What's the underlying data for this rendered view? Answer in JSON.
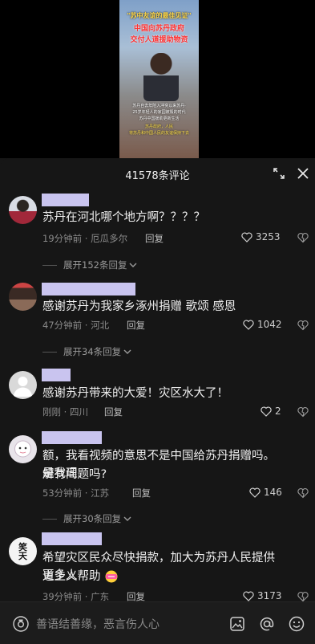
{
  "video": {
    "thumb_title_1": "\"苏中友谊的最佳见证\"",
    "thumb_title_2": "中国向苏丹政府",
    "thumb_title_3": "交付人道援助物资",
    "thumb_caption_lines": [
      "苏丹自去年陷入冲突以来苏丹·",
      "25岁年轻人的家园被毁的时代",
      "苏丹中国援助更新生活",
      "苏丹政府，人民",
      "将苏丹和中国人民的友谊保持下去"
    ]
  },
  "panel": {
    "title": "41578条评论"
  },
  "comments": [
    {
      "text": "苏丹在河北哪个地方啊？？？？",
      "time": "19分钟前",
      "location": "厄瓜多尔",
      "reply_label": "回复",
      "likes": "3253",
      "expand_label": "展开152条回复"
    },
    {
      "text": "感谢苏丹为我家乡涿州捐赠 歌颂 感恩",
      "time": "47分钟前",
      "location": "河北",
      "reply_label": "回复",
      "likes": "1042",
      "expand_label": "展开34条回复"
    },
    {
      "text": "感谢苏丹带来的大爱！灾区水大了！",
      "time": "刚刚",
      "location": "四川",
      "reply_label": "回复",
      "likes": "2"
    },
    {
      "text_line1": "额，我看视频的意思不是中国给苏丹捐赠吗。是我理",
      "text_line2": "解有问题吗?",
      "time": "53分钟前",
      "location": "江苏",
      "reply_label": "回复",
      "likes": "146",
      "expand_label": "展开30条回复"
    },
    {
      "text_line1": "希望灾区民众尽快捐款，加大为苏丹人民提供更多人",
      "text_line2": "道主义帮助",
      "time": "39分钟前",
      "location": "广东",
      "reply_label": "回复",
      "likes": "3173",
      "avatar_text": "笑天"
    }
  ],
  "input": {
    "placeholder": "善语结善缘，恶言伤人心"
  },
  "icons": [
    "expand-icon",
    "close-icon",
    "heart-icon",
    "dislike-icon",
    "chevron-down-icon",
    "camera-icon",
    "image-icon",
    "at-icon",
    "emoji-icon"
  ],
  "colors": {
    "background": "#161616",
    "name_placeholder": "#c9c4ef"
  }
}
